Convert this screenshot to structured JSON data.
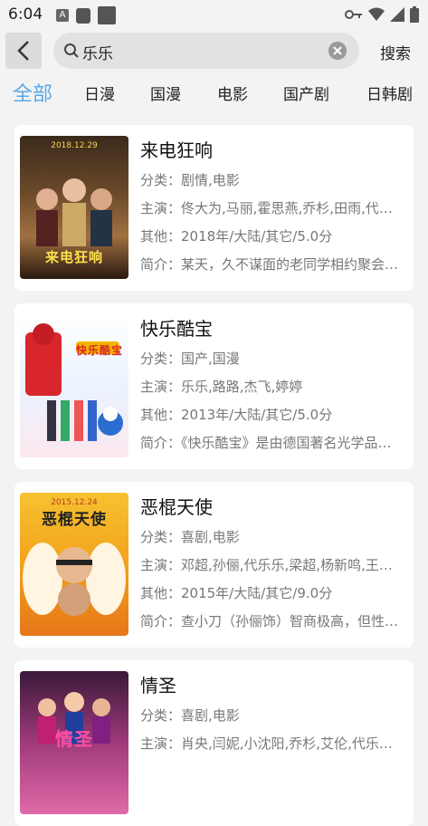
{
  "status": {
    "time": "6:04",
    "a_icon_label": "A"
  },
  "search": {
    "query": "乐乐",
    "button_label": "搜索"
  },
  "tabs": [
    "全部",
    "日漫",
    "国漫",
    "电影",
    "国产剧",
    "日韩剧"
  ],
  "movies": [
    {
      "title": "来电狂响",
      "category": "分类：剧情,电影",
      "cast": "主演：佟大为,马丽,霍思燕,乔杉,田雨,代…",
      "other": "其他：2018年/大陆/其它/5.0分",
      "summary": "简介：某天，久不谋面的老同学相约聚会…",
      "poster_title": "来电狂响",
      "poster_top": "2018.12.29"
    },
    {
      "title": "快乐酷宝",
      "category": "分类：国产,国漫",
      "cast": "主演：乐乐,路路,杰飞,婷婷",
      "other": "其他：2013年/大陆/其它/5.0分",
      "summary": "简介：《快乐酷宝》是由德国著名光学品…",
      "poster_title": "快乐酷宝",
      "poster_top": ""
    },
    {
      "title": "恶棍天使",
      "category": "分类：喜剧,电影",
      "cast": "主演：邓超,孙俪,代乐乐,梁超,杨新鸣,王…",
      "other": "其他：2015年/大陆/其它/9.0分",
      "summary": "简介：查小刀（孙俪饰）智商极高，但性…",
      "poster_title": "恶棍天使",
      "poster_top": "2015.12.24"
    },
    {
      "title": "情圣",
      "category": "分类：喜剧,电影",
      "cast": "主演：肖央,闫妮,小沈阳,乔杉,艾伦,代乐…",
      "other": "",
      "summary": "",
      "poster_title": "情圣",
      "poster_top": ""
    }
  ],
  "colors": {
    "accent": "#5aa8ea",
    "background": "#f3f3f3"
  }
}
